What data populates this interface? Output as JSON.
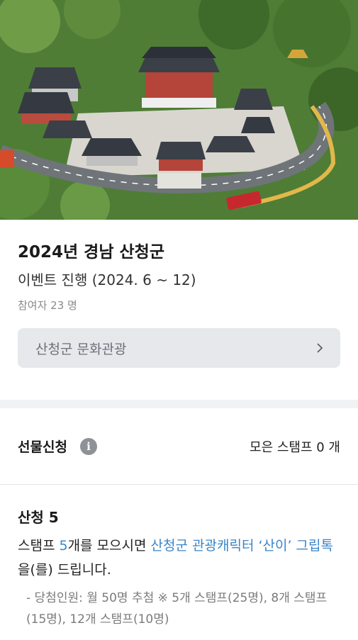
{
  "hero": {
    "image_alt": "산청 동의보감촌 항공 사진"
  },
  "event": {
    "title": "2024년 경남 산청군",
    "subtitle": "이벤트 진행 (2024. 6 ~ 12)",
    "participants": "참여자 23 명",
    "org_button_label": "산청군 문화관광",
    "org_button_icon": "chevron-right-icon"
  },
  "gift": {
    "title": "선물신청",
    "info_icon_glyph": "i",
    "collected_label": "모은 스탬프 0 개"
  },
  "stage": {
    "title": "산청 5",
    "desc_prefix": "스탬프 ",
    "desc_count": "5",
    "desc_mid": "개를 모으시면 ",
    "desc_reward": "산청군 관광캐릭터 ‘산이’ 그립톡",
    "desc_suffix": "을(를) 드립니다.",
    "note": "- 당첨인원: 월 50명 추첨  ※ 5개 스탬프(25명), 8개 스탬프(15명), 12개 스탬프(10명)"
  },
  "colors": {
    "accent": "#3a86c8",
    "button_bg": "#e6e8ec",
    "band": "#f1f2f4"
  }
}
